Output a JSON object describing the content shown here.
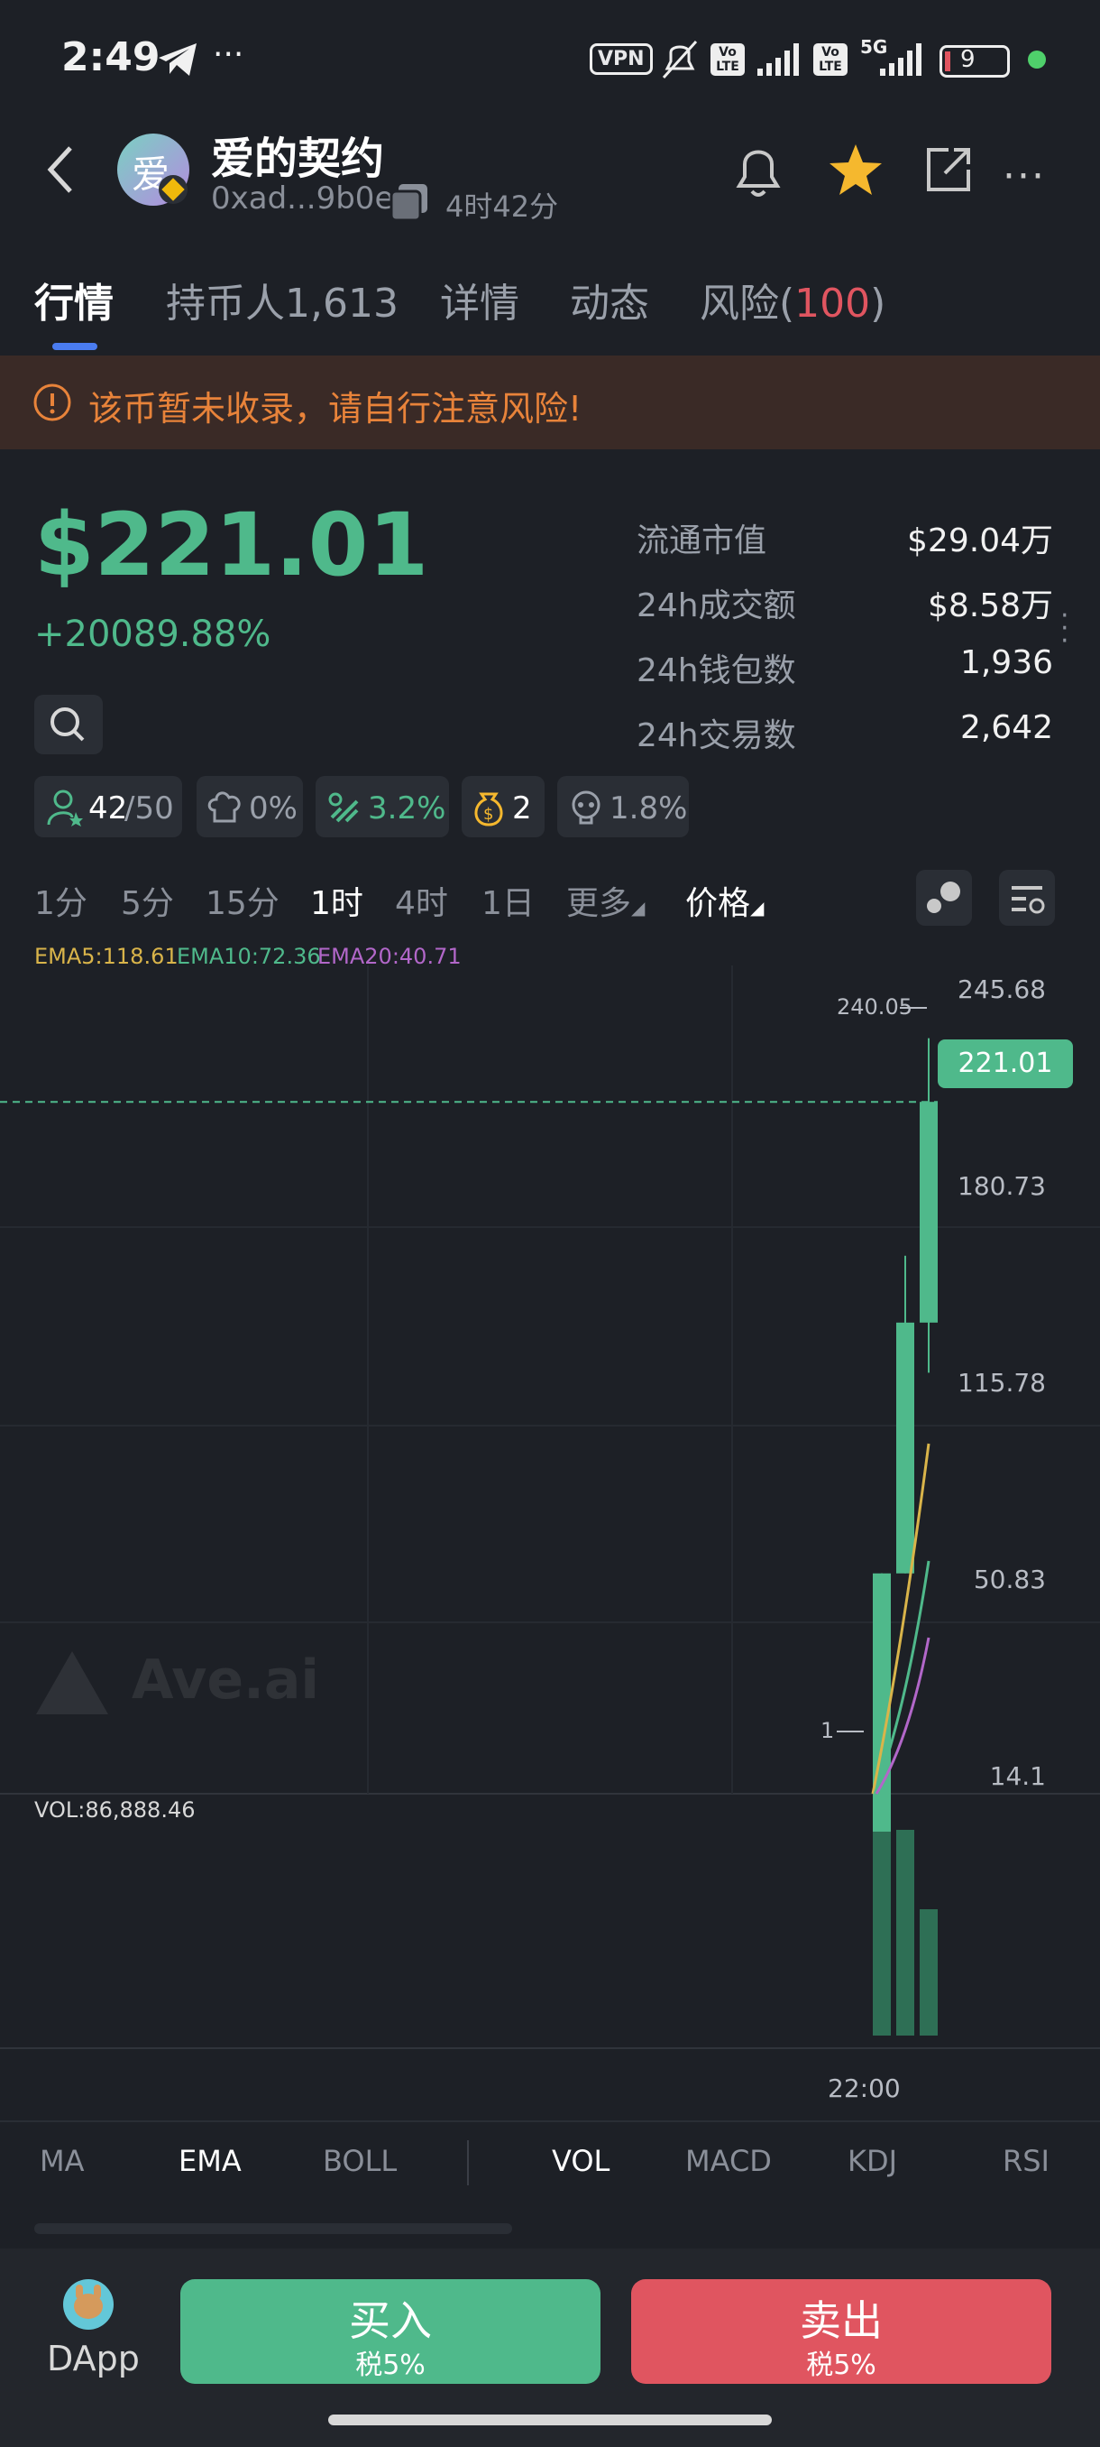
{
  "status_bar": {
    "time": "2:49",
    "battery": "9",
    "network": "5G",
    "vpn": "VPN",
    "volte": "Vo LTE"
  },
  "token": {
    "name": "爱的契约",
    "avatar_char": "爱",
    "address": "0xad...9b0e",
    "age": "4时42分"
  },
  "tabs": {
    "market": "行情",
    "holders": "持币人1,613",
    "details": "详情",
    "activity": "动态",
    "risk_label": "风险",
    "risk_open": "(",
    "risk_value": "100",
    "risk_close": ")"
  },
  "banner": {
    "text": "该币暂未收录，请自行注意风险!"
  },
  "price": {
    "value": "$221.01",
    "change": "+20089.88%"
  },
  "stats": [
    {
      "label": "流通市值",
      "value": "$29.04万"
    },
    {
      "label": "24h成交额",
      "value": "$8.58万"
    },
    {
      "label": "24h钱包数",
      "value": "1,936"
    },
    {
      "label": "24h交易数",
      "value": "2,642"
    }
  ],
  "chips": {
    "holders_top": "42",
    "holders_total": "/50",
    "dev": "0%",
    "bundle": "3.2%",
    "insiders": "2",
    "sniper": "1.8%"
  },
  "timeframes": [
    "1分",
    "5分",
    "15分",
    "1时",
    "4时",
    "1日"
  ],
  "timeframe_more": "更多",
  "price_menu": "价格",
  "ema": {
    "ema5": "EMA5:118.61",
    "ema10": "EMA10:72.36",
    "ema20": "EMA20:40.71"
  },
  "chart": {
    "y_labels": [
      "245.68",
      "180.73",
      "115.78",
      "50.83",
      "14.1"
    ],
    "current_price": "221.01",
    "high_marker": "240.05",
    "low_marker": "1",
    "watermark": "Ave.ai",
    "vol_label": "VOL:86,888.46",
    "x_label": "22:00"
  },
  "chart_data": {
    "type": "candlestick",
    "candles": [
      {
        "open": 1,
        "close": 80,
        "high": 80,
        "low": 1
      },
      {
        "open": 80,
        "close": 155,
        "high": 175,
        "low": 80
      },
      {
        "open": 155,
        "close": 221.01,
        "high": 240.05,
        "low": 140
      }
    ],
    "ylim": [
      14.1,
      245.68
    ],
    "colors": {
      "up": "#4fb98b",
      "ema5": "#d9b44a",
      "ema10": "#4fb98b",
      "ema20": "#b267c9"
    }
  },
  "indicator_tabs": [
    "MA",
    "EMA",
    "BOLL",
    "VOL",
    "MACD",
    "KDJ",
    "RSI"
  ],
  "bottom": {
    "dapp": "DApp",
    "buy": "买入",
    "buy_tax": "税5%",
    "sell": "卖出",
    "sell_tax": "税5%"
  },
  "colors": {
    "accent_green": "#4fb98b",
    "accent_red": "#e05560",
    "warning": "#e8833a"
  }
}
